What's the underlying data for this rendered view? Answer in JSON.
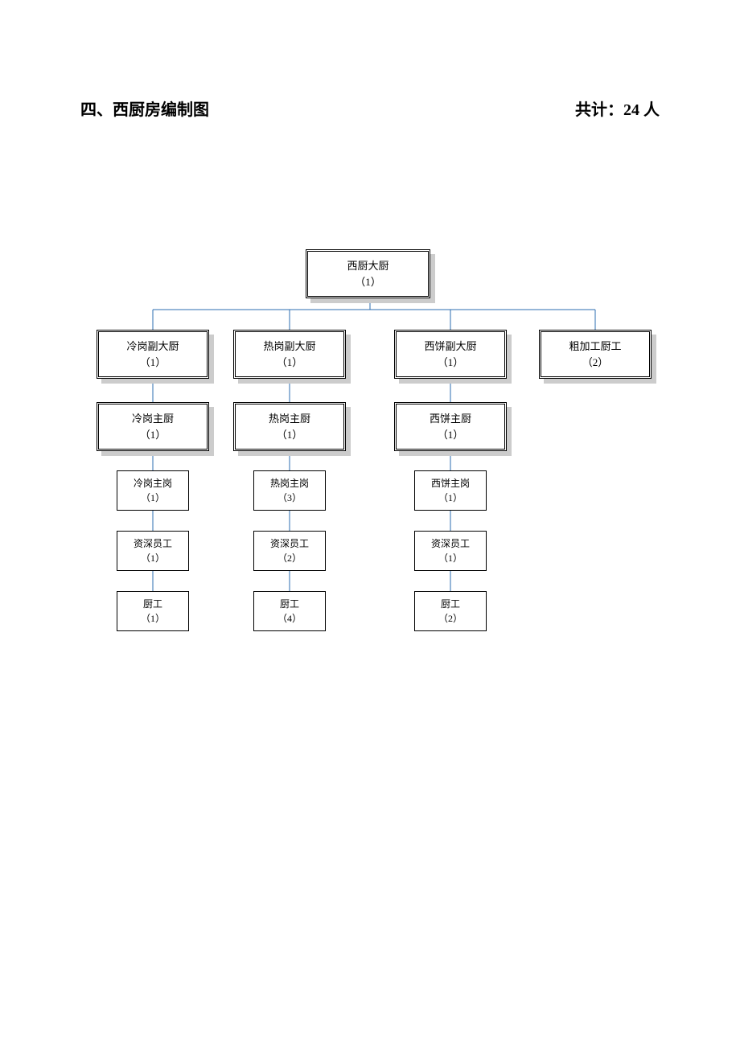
{
  "header": {
    "title": "四、西厨房编制图",
    "total": "共计：24 人"
  },
  "chart_data": {
    "type": "tree",
    "root": {
      "title": "西厨大厨",
      "count": "（1）"
    },
    "branches": [
      {
        "deputy": {
          "title": "冷岗副大厨",
          "count": "（1）"
        },
        "head": {
          "title": "冷岗主厨",
          "count": "（1）"
        },
        "lead": {
          "title": "冷岗主岗",
          "count": "（1）"
        },
        "senior": {
          "title": "资深员工",
          "count": "（1）"
        },
        "cook": {
          "title": "厨工",
          "count": "（1）"
        }
      },
      {
        "deputy": {
          "title": "热岗副大厨",
          "count": "（1）"
        },
        "head": {
          "title": "热岗主厨",
          "count": "（1）"
        },
        "lead": {
          "title": "热岗主岗",
          "count": "（3）"
        },
        "senior": {
          "title": "资深员工",
          "count": "（2）"
        },
        "cook": {
          "title": "厨工",
          "count": "（4）"
        }
      },
      {
        "deputy": {
          "title": "西饼副大厨",
          "count": "（1）"
        },
        "head": {
          "title": "西饼主厨",
          "count": "（1）"
        },
        "lead": {
          "title": "西饼主岗",
          "count": "（1）"
        },
        "senior": {
          "title": "资深员工",
          "count": "（1）"
        },
        "cook": {
          "title": "厨工",
          "count": "（2）"
        }
      },
      {
        "deputy": {
          "title": "粗加工厨工",
          "count": "（2）"
        }
      }
    ]
  }
}
